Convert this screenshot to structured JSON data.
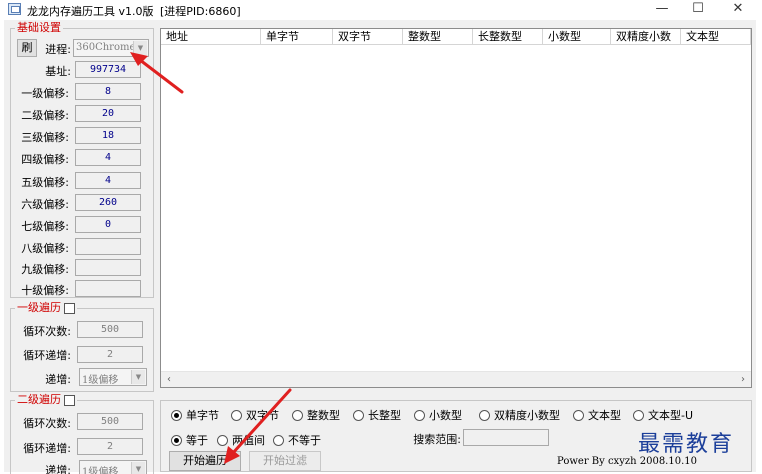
{
  "window": {
    "title": "龙龙内存遍历工具 v1.0版",
    "pid_label": "[进程PID:6860]",
    "minimize": "—",
    "maximize": "☐",
    "close": "✕"
  },
  "base_group": {
    "legend": "基础设置",
    "refresh_button": "刷",
    "process_label": "进程:",
    "process_value": "360ChromeX.",
    "base_address_label": "基址:",
    "base_address_value": "997734",
    "offsets": [
      {
        "label": "一级偏移:",
        "value": "8"
      },
      {
        "label": "二级偏移:",
        "value": "20"
      },
      {
        "label": "三级偏移:",
        "value": "18"
      },
      {
        "label": "四级偏移:",
        "value": "4"
      },
      {
        "label": "五级偏移:",
        "value": "4"
      },
      {
        "label": "六级偏移:",
        "value": "260"
      },
      {
        "label": "七级偏移:",
        "value": "0"
      },
      {
        "label": "八级偏移:",
        "value": ""
      },
      {
        "label": "九级偏移:",
        "value": ""
      },
      {
        "label": "十级偏移:",
        "value": ""
      }
    ]
  },
  "traverse1": {
    "legend": "一级遍历",
    "loop_count_label": "循环次数:",
    "loop_count_value": "500",
    "loop_inc_label": "循环递增:",
    "loop_inc_value": "2",
    "inc_label": "递增:",
    "inc_value": "1级偏移"
  },
  "traverse2": {
    "legend": "二级遍历",
    "loop_count_label": "循环次数:",
    "loop_count_value": "500",
    "loop_inc_label": "循环递增:",
    "loop_inc_value": "2",
    "inc_label": "递增:",
    "inc_value": "1级偏移"
  },
  "list": {
    "columns": [
      "地址",
      "单字节",
      "双字节",
      "整数型",
      "长整数型",
      "小数型",
      "双精度小数",
      "文本型"
    ]
  },
  "options": {
    "types": [
      "单字节",
      "双字节",
      "整数型",
      "长整型",
      "小数型",
      "双精度小数型",
      "文本型",
      "文本型-U"
    ],
    "conditions": [
      "等于",
      "两值间",
      "不等于"
    ],
    "search_range_label": "搜索范围:",
    "start_button": "开始遍历",
    "filter_button": "开始过滤",
    "power_text": "Power By cxyzh 2008.10.10"
  },
  "watermark": "最需教育",
  "colors": {
    "legend": "#d00000",
    "value_text": "#00008b",
    "annotation_arrow": "#e02020"
  }
}
